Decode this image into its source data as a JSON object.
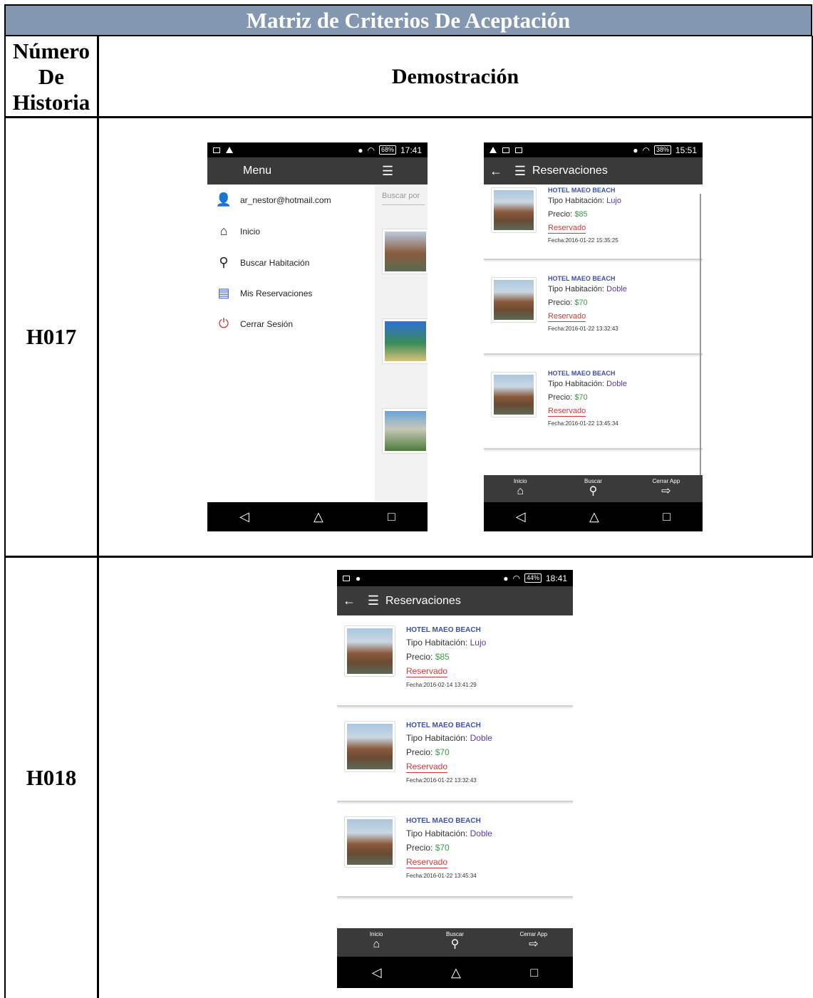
{
  "document": {
    "title": "Matriz de Criterios De Aceptación",
    "header_col1": "Número De Historia",
    "header_col2": "Demostración",
    "rows": [
      {
        "story": "H017"
      },
      {
        "story": "H018"
      }
    ]
  },
  "colors": {
    "title_bg": "#8497b0",
    "app_bar": "#3a3a3a",
    "hotel_name": "#3d4fa8",
    "tipo_value": "#5a3aa0",
    "price_value": "#3aa04a",
    "reserved": "#d23a3a"
  },
  "phone_menu": {
    "status_time": "17:41",
    "battery": "68%",
    "title": "Menu",
    "search_placeholder": "Buscar por",
    "items": [
      {
        "label": "ar_nestor@hotmail.com",
        "icon": "person-icon"
      },
      {
        "label": "Inicio",
        "icon": "home-icon"
      },
      {
        "label": "Buscar Habitación",
        "icon": "search-icon"
      },
      {
        "label": "Mis Reservaciones",
        "icon": "document-icon"
      },
      {
        "label": "Cerrar Sesión",
        "icon": "power-icon"
      }
    ]
  },
  "phone_res1": {
    "status_time": "15:51",
    "battery": "38%",
    "title": "Reservaciones",
    "cards": [
      {
        "hotel": "HOTEL MAEO BEACH",
        "tipo_label": "Tipo Habitación:",
        "tipo": "Lujo",
        "precio_label": "Precio:",
        "precio": "$85",
        "estado": "Reservado",
        "fecha": "Fecha:2016-01-22 15:35:25"
      },
      {
        "hotel": "HOTEL MAEO BEACH",
        "tipo_label": "Tipo Habitación:",
        "tipo": "Doble",
        "precio_label": "Precio:",
        "precio": "$70",
        "estado": "Reservado",
        "fecha": "Fecha:2016-01-22 13:32:43"
      },
      {
        "hotel": "HOTEL MAEO BEACH",
        "tipo_label": "Tipo Habitación:",
        "tipo": "Doble",
        "precio_label": "Precio:",
        "precio": "$70",
        "estado": "Reservado",
        "fecha": "Fecha:2016-01-22 13:45:34"
      }
    ],
    "bottom_menu": [
      "Inicio",
      "Buscar",
      "Cerrar App"
    ]
  },
  "phone_res2": {
    "status_time": "18:41",
    "battery": "44%",
    "title": "Reservaciones",
    "cards": [
      {
        "hotel": "HOTEL MAEO BEACH",
        "tipo_label": "Tipo Habitación:",
        "tipo": "Lujo",
        "precio_label": "Precio:",
        "precio": "$85",
        "estado": "Reservado",
        "fecha": "Fecha:2016-02-14 13:41:29"
      },
      {
        "hotel": "HOTEL MAEO BEACH",
        "tipo_label": "Tipo Habitación:",
        "tipo": "Doble",
        "precio_label": "Precio:",
        "precio": "$70",
        "estado": "Reservado",
        "fecha": "Fecha:2016-01-22 13:32:43"
      },
      {
        "hotel": "HOTEL MAEO BEACH",
        "tipo_label": "Tipo Habitación:",
        "tipo": "Doble",
        "precio_label": "Precio:",
        "precio": "$70",
        "estado": "Reservado",
        "fecha": "Fecha:2016-01-22 13:45:34"
      }
    ],
    "bottom_menu": [
      "Inicio",
      "Buscar",
      "Cerrar App"
    ]
  }
}
